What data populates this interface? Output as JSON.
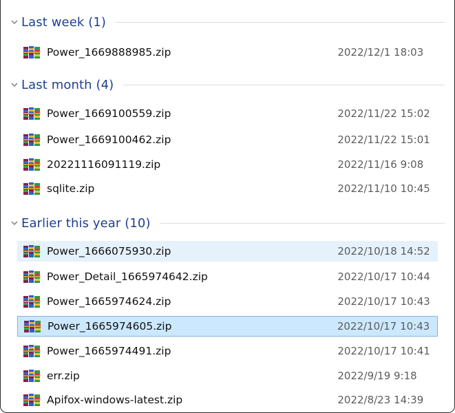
{
  "groups": [
    {
      "title": "Last week (1)",
      "files": [
        {
          "name": "Power_1669888985.zip",
          "date": "2022/12/1 18:03",
          "state": "normal"
        }
      ]
    },
    {
      "title": "Last month (4)",
      "files": [
        {
          "name": "Power_1669100559.zip",
          "date": "2022/11/22 15:02",
          "state": "normal"
        },
        {
          "name": "Power_1669100462.zip",
          "date": "2022/11/22 15:01",
          "state": "normal"
        },
        {
          "name": "20221116091119.zip",
          "date": "2022/11/16 9:08",
          "state": "normal"
        },
        {
          "name": "sqlite.zip",
          "date": "2022/11/10 10:45",
          "state": "normal"
        }
      ]
    },
    {
      "title": "Earlier this year (10)",
      "files": [
        {
          "name": "Power_1666075930.zip",
          "date": "2022/10/18 14:52",
          "state": "hover"
        },
        {
          "name": "Power_Detail_1665974642.zip",
          "date": "2022/10/17 10:44",
          "state": "normal"
        },
        {
          "name": "Power_1665974624.zip",
          "date": "2022/10/17 10:43",
          "state": "normal"
        },
        {
          "name": "Power_1665974605.zip",
          "date": "2022/10/17 10:43",
          "state": "selected"
        },
        {
          "name": "Power_1665974491.zip",
          "date": "2022/10/17 10:41",
          "state": "normal"
        },
        {
          "name": "err.zip",
          "date": "2022/9/19 9:18",
          "state": "normal"
        },
        {
          "name": "Apifox-windows-latest.zip",
          "date": "2022/8/23 14:39",
          "state": "normal"
        }
      ]
    }
  ],
  "icons": {
    "group_chevron": "chevron-down-icon",
    "file": "winrar-archive-icon"
  },
  "colors": {
    "group_title": "#1f3f8f",
    "hover_row": "#e5f1fb",
    "selected_row": "#cce8ff",
    "selected_border": "#7fb6e2"
  }
}
